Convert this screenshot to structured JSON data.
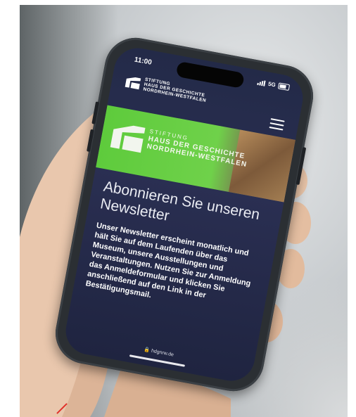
{
  "phone": {
    "status_time": "11:00",
    "network": "5G"
  },
  "site": {
    "logo_line1": "STIFTUNG",
    "logo_line2": "HAUS DER GESCHICHTE",
    "logo_line3": "NORDRHEIN-WESTFALEN",
    "banner_line1": "STIFTUNG",
    "banner_line2": "HAUS DER GESCHICHTE",
    "banner_line3": "NORDRHEIN-WESTFALEN",
    "headline": "Abonnieren Sie unseren Newsletter",
    "body": "Unser Newsletter erscheint monatlich und hält Sie auf dem Laufenden über das Museum, unsere Ausstellungen und Veranstaltungen. Nutzen Sie zur Anmeldung das Anmeldeformular und klicken Sie anschließend auf den Link in der Bestätigungsmail.",
    "url": "hdgnrw.de"
  },
  "colors": {
    "screen_bg": "#232a48",
    "banner_green": "#6fd14a",
    "case": "#2b2f33"
  },
  "icons": [
    "signal-icon",
    "battery-icon",
    "menu-icon",
    "logo-icon"
  ]
}
